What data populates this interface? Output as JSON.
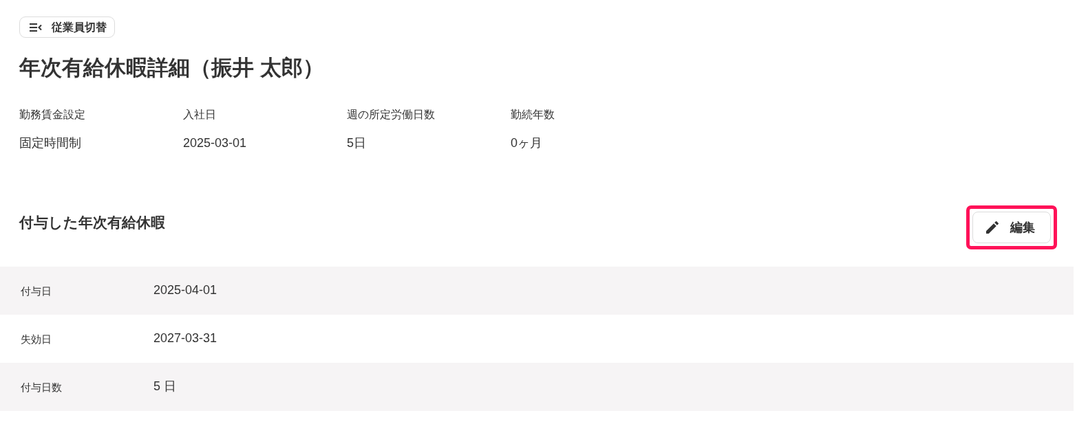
{
  "switch_button": {
    "label": "従業員切替"
  },
  "title": "年次有給休暇詳細（振井 太郎）",
  "info": [
    {
      "label": "勤務賃金設定",
      "value": "固定時間制"
    },
    {
      "label": "入社日",
      "value": "2025-03-01"
    },
    {
      "label": "週の所定労働日数",
      "value": "5日"
    },
    {
      "label": "勤続年数",
      "value": "0ヶ月"
    }
  ],
  "section": {
    "title": "付与した年次有給休暇",
    "edit_button": {
      "label": "編集",
      "highlighted": true
    }
  },
  "rows": [
    {
      "label": "付与日",
      "value": "2025-04-01"
    },
    {
      "label": "失効日",
      "value": "2027-03-31"
    },
    {
      "label": "付与日数",
      "value": "5 日"
    }
  ]
}
